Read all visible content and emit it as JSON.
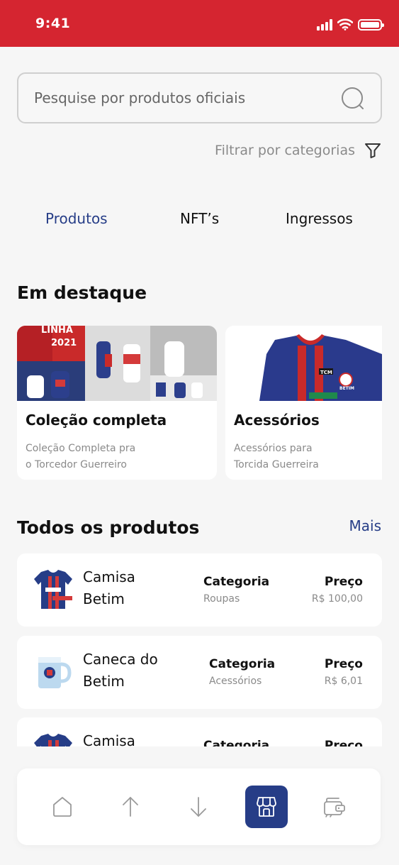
{
  "status_bar": {
    "time": "9:41"
  },
  "search": {
    "placeholder": "Pesquise por produtos oficiais"
  },
  "filter": {
    "label": "Filtrar por categorias"
  },
  "tabs": [
    {
      "label": "Produtos",
      "active": true
    },
    {
      "label": "NFT’s",
      "active": false
    },
    {
      "label": "Ingressos",
      "active": false
    }
  ],
  "featured": {
    "title": "Em destaque",
    "cards": [
      {
        "title": "Coleção completa",
        "desc_line1": "Coleção Completa pra",
        "desc_line2": "o Torcedor Guerreiro",
        "banner_text_1": "LINHA",
        "banner_text_2": "2021"
      },
      {
        "title": "Acessórios",
        "desc_line1": "Acessórios para",
        "desc_line2": "Torcida Guerreira",
        "badge_text": "TCM",
        "crest_text": "BETIM"
      }
    ]
  },
  "all_products": {
    "title": "Todos os produtos",
    "more_label": "Mais",
    "category_header": "Categoria",
    "price_header": "Preço",
    "items": [
      {
        "name_line1": "Camisa",
        "name_line2": "Betim",
        "category": "Roupas",
        "price": "R$ 100,00",
        "thumb": "jersey"
      },
      {
        "name_line1": "Caneca do",
        "name_line2": "Betim",
        "category": "Acessórios",
        "price": "R$ 6,01",
        "thumb": "mug"
      },
      {
        "name_line1": "Camisa",
        "name_line2": "",
        "category": "",
        "price": "",
        "thumb": "jersey"
      }
    ]
  },
  "bottom_nav": {
    "items": [
      {
        "icon": "home-icon",
        "active": false
      },
      {
        "icon": "arrow-up-icon",
        "active": false
      },
      {
        "icon": "arrow-down-icon",
        "active": false
      },
      {
        "icon": "store-icon",
        "active": true
      },
      {
        "icon": "wallet-icon",
        "active": false
      }
    ]
  },
  "colors": {
    "brand_red": "#d52530",
    "brand_blue": "#263d87",
    "muted_text": "#8a8a8a",
    "background": "#f6f6f6"
  }
}
